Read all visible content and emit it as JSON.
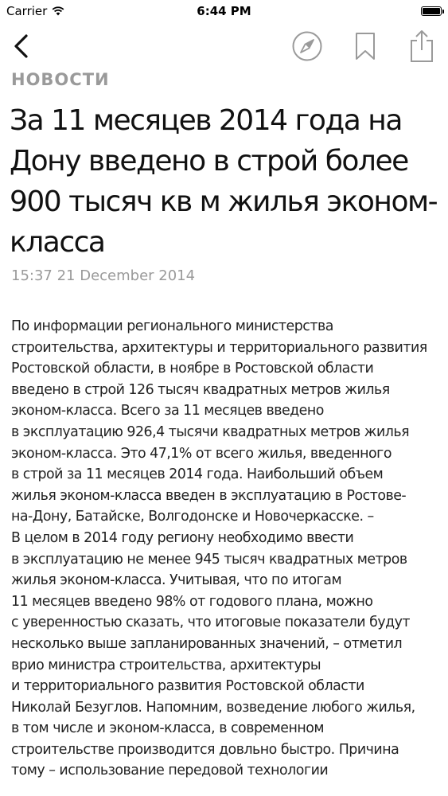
{
  "status_bar": {
    "carrier": "Carrier",
    "time": "6:44 PM"
  },
  "nav": {
    "back_icon": "chevron-left-icon",
    "compass_icon": "compass-icon",
    "bookmark_icon": "bookmark-icon",
    "share_icon": "share-icon"
  },
  "article": {
    "category": "НОВОСТИ",
    "title": "За 11 месяцев 2014 года на Дону введено в строй более 900 тысяч кв м жилья эконом-класса",
    "timestamp": "15:37 21 December 2014",
    "body": "По информации регионального министерства\nстроительства, архитектуры и территориального развития\nРостовской области, в ноябре в Ростовской области\nвведено в строй 126 тысяч квадратных метров жилья\nэконом-класса. Всего за 11 месяцев введено\nв эксплуатацию 926,4 тысячи квадратных метров жилья\nэконом-класса. Это 47,1% от всего жилья, введенного\nв строй за 11 месяцев 2014 года. Наибольший объем\nжилья эконом-класса введен в эксплуатацию в  Ростове-\nна-Дону, Батайске, Волгодонске и Новочеркасске. –\nВ целом в 2014 году региону необходимо ввести\nв эксплуатацию не менее 945 тысяч квадратных метров\nжилья эконом-класса. Учитывая, что по итогам\n11 месяцев введено 98% от годового плана, можно\nс уверенностью сказать, что итоговые показатели будут\nнесколько выше запланированных значений, – отметил\nврио министра строительства, архитектуры\nи территориального развития Ростовской области\nНиколай Безуглов. Напомним, возведение любого жилья,\nв том числе и  эконом-класса, в современном\nстроительстве производится довльно быстро. Причина\nтому – использование передовой технологии"
  },
  "colors": {
    "icon_gray": "#9a9a9a",
    "text": "#111111",
    "meta_gray": "#9a9a9a"
  }
}
